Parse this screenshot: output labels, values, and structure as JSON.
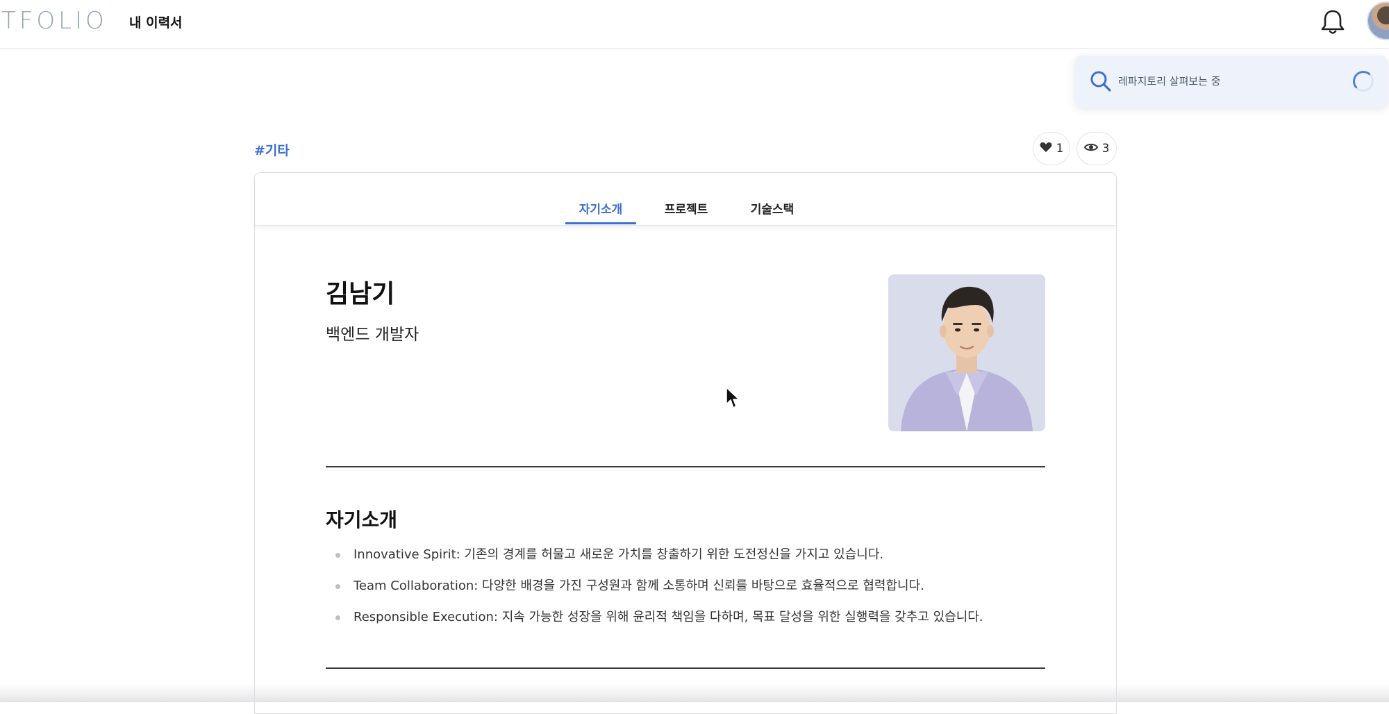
{
  "header": {
    "logo": "TFOLIO",
    "nav_resume": "내 이력서"
  },
  "toast": {
    "text": "레파지토리 살펴보는 중"
  },
  "post": {
    "category": "#기타",
    "likes": "1",
    "views": "3"
  },
  "tabs": [
    {
      "label": "자기소개",
      "active": true
    },
    {
      "label": "프로젝트",
      "active": false
    },
    {
      "label": "기술스택",
      "active": false
    }
  ],
  "profile": {
    "name": "김남기",
    "role": "백엔드 개발자"
  },
  "intro": {
    "title": "자기소개",
    "items": [
      "Innovative Spirit: 기존의 경계를 허물고 새로운 가치를 창출하기 위한 도전정신을 가지고 있습니다.",
      "Team Collaboration: 다양한 배경을 가진 구성원과 함께 소통하며 신뢰를 바탕으로 효율적으로 협력합니다.",
      "Responsible Execution: 지속 가능한 성장을 위해 윤리적 책임을 다하며, 목표 달성을 위한 실행력을 갖추고 있습니다."
    ]
  },
  "colors": {
    "accent": "#3d6fcf",
    "logo": "#8fa3b5",
    "toast_bg": "#eef3fb"
  },
  "icons": {
    "bell": "bell-icon",
    "search": "search-icon",
    "heart": "heart-icon",
    "eye": "eye-icon",
    "spinner": "spinner-icon"
  }
}
